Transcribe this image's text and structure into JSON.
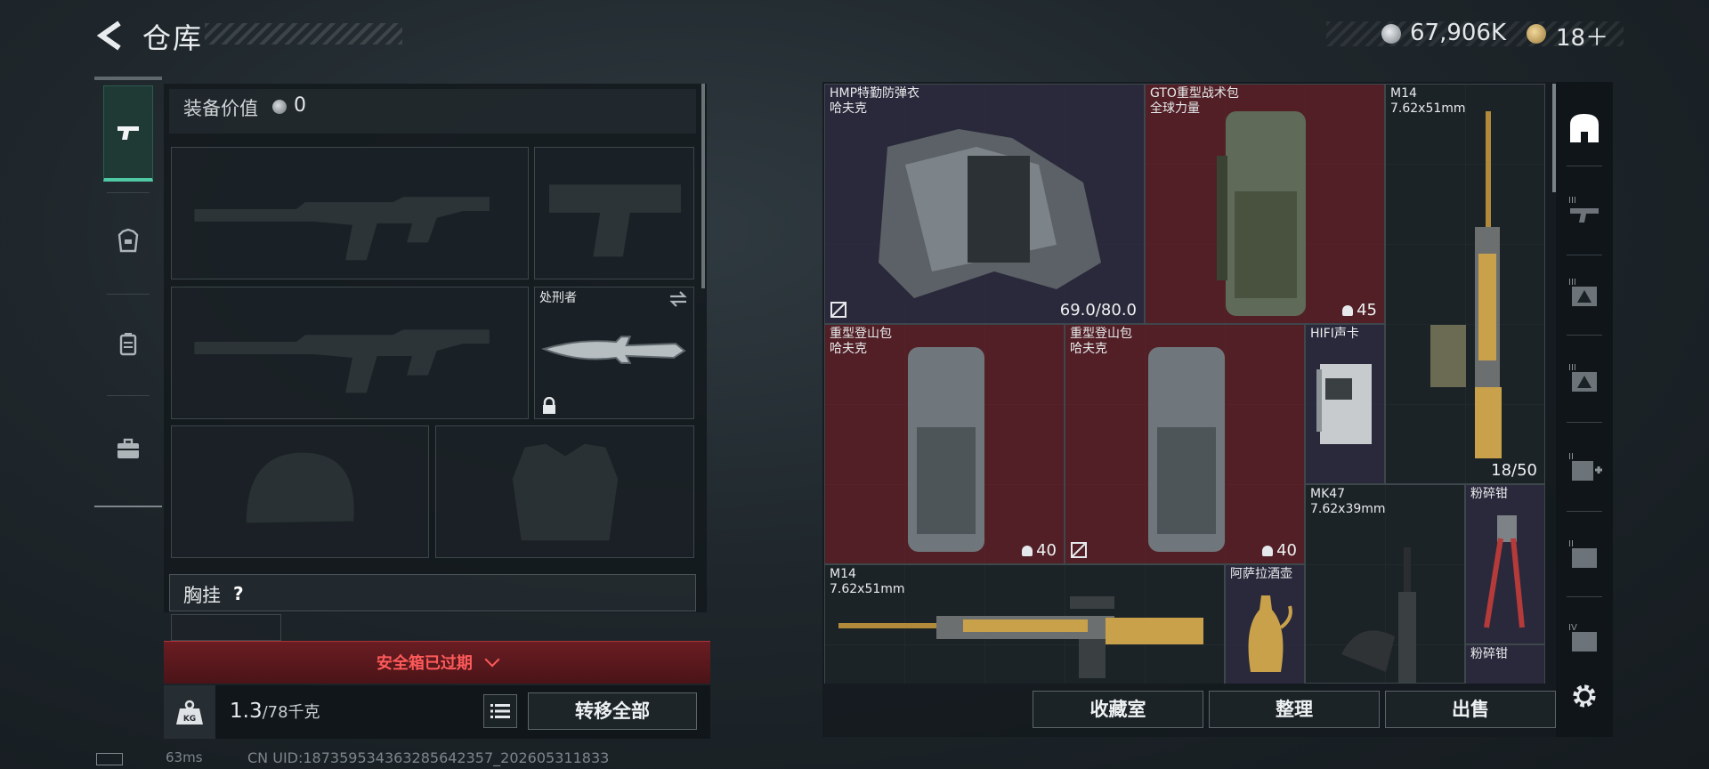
{
  "header": {
    "title": "仓库"
  },
  "currency": {
    "money": "67,906K",
    "tokens": "18＋"
  },
  "equipment": {
    "value_label": "装备价值",
    "value": "0",
    "melee_name": "处刑者",
    "chest_label": "胸挂",
    "chest_help": "?"
  },
  "safe_box": {
    "status": "安全箱已过期"
  },
  "weight": {
    "current": "1.3",
    "max": "/78千克"
  },
  "buttons": {
    "transfer_all": "转移全部",
    "collection": "收藏室",
    "organize": "整理",
    "sell": "出售"
  },
  "status_bar": {
    "ping": "63ms",
    "uid": "CN UID:1873595343632856423​57_202605311833"
  },
  "inventory": {
    "items": [
      {
        "name": "HMP特勤防弹衣",
        "sub": "哈夫克",
        "count": "69.0/80.0"
      },
      {
        "name": "GTO重型战术包",
        "sub": "全球力量",
        "count": "45"
      },
      {
        "name": "M14",
        "sub": "7.62x51mm",
        "count": "18/50"
      },
      {
        "name": "重型登山包",
        "sub": "哈夫克",
        "count": "40"
      },
      {
        "name": "重型登山包",
        "sub": "哈夫克",
        "count": "40"
      },
      {
        "name": "HIFI声卡",
        "sub": ""
      },
      {
        "name": "MK47",
        "sub": "7.62x39mm"
      },
      {
        "name": "粉碎钳",
        "sub": ""
      },
      {
        "name": "M14",
        "sub": "7.62x51mm"
      },
      {
        "name": "阿萨拉酒壶",
        "sub": ""
      },
      {
        "name": "粉碎钳",
        "sub": ""
      }
    ]
  },
  "colors": {
    "accent": "#4ec9a4",
    "rarity_red": "#5a1e26",
    "rarity_purple": "#2c2a3e",
    "warning": "#ff5a5a"
  }
}
